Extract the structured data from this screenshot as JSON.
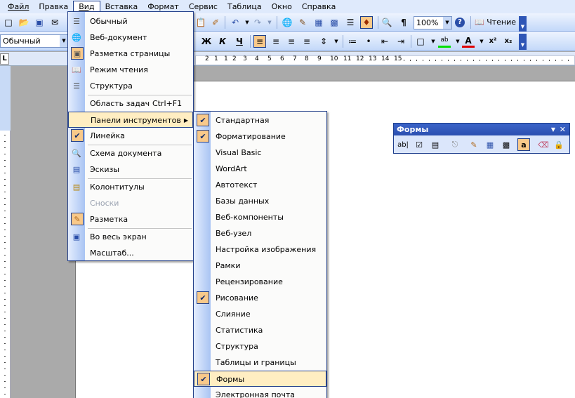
{
  "menubar": {
    "items": [
      "Файл",
      "Правка",
      "Вид",
      "Вставка",
      "Формат",
      "Сервис",
      "Таблица",
      "Окно",
      "Справка"
    ],
    "open_index": 2
  },
  "toolbar_standard": {
    "zoom": "100%",
    "read_label": "Чтение"
  },
  "toolbar_formatting": {
    "style": "Обычный",
    "bold": "Ж",
    "italic": "К",
    "underline": "Ч"
  },
  "ruler": {
    "corner": "L",
    "numbers": [
      "2",
      "1",
      "1",
      "2",
      "3",
      "4",
      "5",
      "6",
      "7",
      "8",
      "9",
      "10",
      "11",
      "12",
      "13",
      "14",
      "15"
    ]
  },
  "view_menu": {
    "items": [
      {
        "label": "Обычный",
        "icon": "normal-view-icon",
        "checked": false
      },
      {
        "label": "Веб-документ",
        "icon": "web-view-icon",
        "checked": false
      },
      {
        "label": "Разметка страницы",
        "icon": "page-layout-icon",
        "checked": true
      },
      {
        "label": "Режим чтения",
        "icon": "reading-mode-icon",
        "checked": false
      },
      {
        "label": "Структура",
        "icon": "outline-icon",
        "checked": false
      },
      {
        "label": "Область задач",
        "shortcut": "Ctrl+F1"
      },
      {
        "label": "Панели инструментов",
        "submenu": true
      },
      {
        "label": "Линейка",
        "icon": "check-icon",
        "checked": true
      },
      {
        "label": "Схема документа",
        "icon": "document-map-icon"
      },
      {
        "label": "Эскизы",
        "icon": "thumbnails-icon"
      },
      {
        "label": "Колонтитулы",
        "icon": "header-footer-icon"
      },
      {
        "label": "Сноски",
        "disabled": true
      },
      {
        "label": "Разметка",
        "icon": "markup-icon",
        "checked": true
      },
      {
        "label": "Во весь экран",
        "icon": "full-screen-icon"
      },
      {
        "label": "Масштаб..."
      }
    ]
  },
  "toolbars_submenu": {
    "items": [
      {
        "label": "Стандартная",
        "checked": true
      },
      {
        "label": "Форматирование",
        "checked": true
      },
      {
        "label": "Visual Basic",
        "checked": false
      },
      {
        "label": "WordArt",
        "checked": false
      },
      {
        "label": "Автотекст",
        "checked": false
      },
      {
        "label": "Базы данных",
        "checked": false
      },
      {
        "label": "Веб-компоненты",
        "checked": false
      },
      {
        "label": "Веб-узел",
        "checked": false
      },
      {
        "label": "Настройка изображения",
        "checked": false
      },
      {
        "label": "Рамки",
        "checked": false
      },
      {
        "label": "Рецензирование",
        "checked": false
      },
      {
        "label": "Рисование",
        "checked": true
      },
      {
        "label": "Слияние",
        "checked": false
      },
      {
        "label": "Статистика",
        "checked": false
      },
      {
        "label": "Структура",
        "checked": false
      },
      {
        "label": "Таблицы и границы",
        "checked": false
      },
      {
        "label": "Формы",
        "checked": true,
        "highlighted": true
      },
      {
        "label": "Электронная почта",
        "checked": false
      }
    ]
  },
  "forms_toolbar": {
    "title": "Формы",
    "text_field_glyph": "ab|",
    "shading_glyph": "a"
  },
  "colors": {
    "accent": "#1c3d8c",
    "highlight": "#ffeec2",
    "checked_bg": "#f9c98a",
    "menubar": "#dfeafc"
  }
}
